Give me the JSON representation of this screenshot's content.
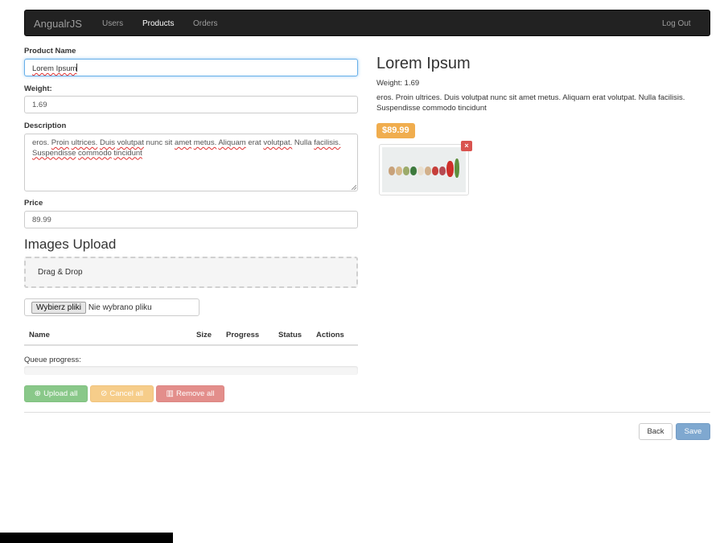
{
  "navbar": {
    "brand": "AngualrJS",
    "links": [
      "Users",
      "Products",
      "Orders"
    ],
    "logout": "Log Out"
  },
  "form": {
    "name_label": "Product Name",
    "name_value": "Lorem Ipsum",
    "weight_label": "Weight:",
    "weight_value": "1.69",
    "description_label": "Description",
    "description_words": [
      "eros.",
      "Proin",
      "ultrices.",
      "Duis",
      "volutpat",
      "nunc sit",
      "amet",
      "metus.",
      "Aliquam",
      "erat",
      "volutpat.",
      "Nulla",
      "facilisis.",
      "Suspendisse",
      "commodo",
      "tincidunt"
    ],
    "price_label": "Price",
    "price_value": "89.99"
  },
  "upload": {
    "title": "Images Upload",
    "dropzone": "Drag & Drop",
    "file_button": "Wybierz pliki",
    "file_status": "Nie wybrano pliku",
    "columns": [
      "Name",
      "Size",
      "Progress",
      "Status",
      "Actions"
    ],
    "queue_label": "Queue progress:",
    "queue_progress": 0,
    "buttons": {
      "upload_all": "Upload all",
      "cancel_all": "Cancel all",
      "remove_all": "Remove all"
    }
  },
  "preview": {
    "title": "Lorem Ipsum",
    "weight": "Weight: 1.69",
    "description": "eros. Proin ultrices. Duis volutpat nunc sit amet metus. Aliquam erat volutpat. Nulla facilisis. Suspendisse commodo tincidunt",
    "price": "$89.99",
    "remove_symbol": "×"
  },
  "footer": {
    "back": "Back",
    "save": "Save"
  },
  "colors": {
    "navbar": "#222222",
    "price_badge": "#f0ad4e",
    "success": "#89c889",
    "warning": "#f6cd8a",
    "danger": "#e38e8b",
    "primary": "#7fa8d0"
  }
}
